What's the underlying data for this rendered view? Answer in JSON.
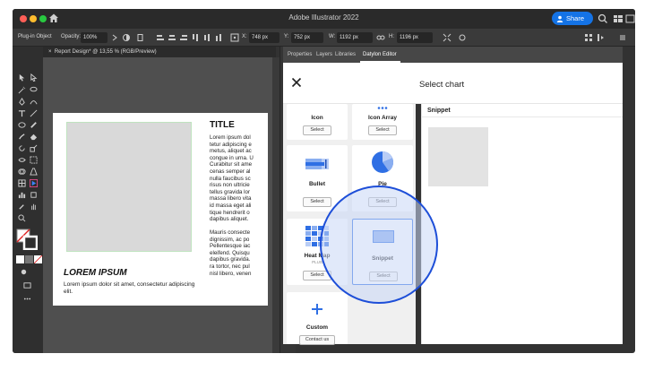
{
  "window": {
    "title": "Adobe Illustrator 2022",
    "share_label": "Share"
  },
  "control_bar": {
    "selection_label": "Plug-in Object",
    "opacity_label": "Opacity:",
    "opacity_value": "100%",
    "x_label": "X:",
    "x_value": "748 px",
    "y_label": "Y:",
    "y_value": "752 px",
    "w_label": "W:",
    "w_value": "1192 px",
    "h_label": "H:",
    "h_value": "1196 px"
  },
  "document": {
    "tab_label": "Report Design* @ 13,55 % (RGB/Preview)",
    "title": "TITLE",
    "body_lines_1": [
      "Lorem ipsum dol",
      "tetur adipiscing e",
      "metus, aliquet ac",
      "congue in urna. U",
      "Curabitur sit ame",
      "cenas semper al",
      "nulla faucibus sc",
      "risus non ultricie",
      "tellus gravida lor",
      "massa libero vita",
      "id massa eget ali",
      "tique hendrerit o",
      "dapibus aliquet."
    ],
    "body_lines_2": [
      "Mauris consecte",
      "dignissim, ac po",
      "Pellentesque iac",
      "eleifend. Quisqu",
      "dapibus gravida.",
      "ra tortor, nec pul",
      "nisl libero, venen"
    ],
    "subtitle": "LOREM IPSUM",
    "caption": "Lorem ipsum dolor sit amet, consectetur adipiscing elit."
  },
  "panel_tabs": [
    {
      "label": "Properties",
      "active": false
    },
    {
      "label": "Layers",
      "active": false
    },
    {
      "label": "Libraries",
      "active": false
    },
    {
      "label": "Datylon Editor",
      "active": true
    }
  ],
  "modal": {
    "title": "Select chart"
  },
  "charts": [
    {
      "name": "Icon",
      "button": "Select"
    },
    {
      "name": "Icon Array",
      "button": "Select"
    },
    {
      "name": "Bullet",
      "button": "Select"
    },
    {
      "name": "Pie",
      "button": "Select"
    },
    {
      "name": "Heat Map",
      "tag": "PLUS",
      "button": "Select"
    },
    {
      "name": "Snippet",
      "button": "Select"
    },
    {
      "name": "Custom",
      "button": "Contact us"
    }
  ],
  "preview": {
    "title": "Snippet"
  },
  "colors": {
    "accent_blue": "#1473e6",
    "chart_blue": "#2f6fe4",
    "highlight_ring": "#1d4ed8"
  }
}
